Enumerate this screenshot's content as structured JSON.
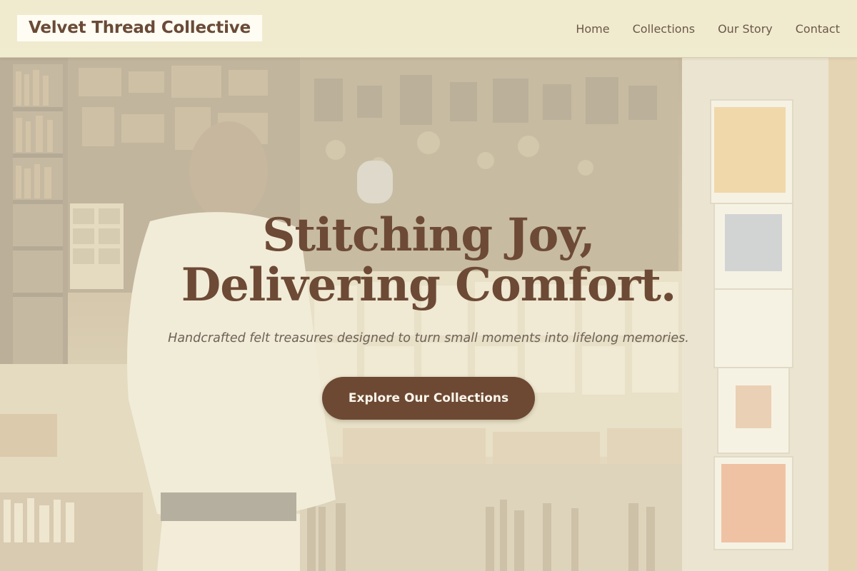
{
  "header": {
    "brand": "Velvet Thread Collective",
    "nav": [
      {
        "label": "Home"
      },
      {
        "label": "Collections"
      },
      {
        "label": "Our Story"
      },
      {
        "label": "Contact"
      }
    ]
  },
  "hero": {
    "title_line1": "Stitching Joy,",
    "title_line2": "Delivering Comfort.",
    "subtitle": "Handcrafted felt treasures designed to turn small moments into lifelong memories.",
    "cta_label": "Explore Our Collections",
    "background_image": "bookshop-interior-photo"
  },
  "colors": {
    "brand_brown": "#6d4934",
    "header_bg": "#f6f3d6",
    "nav_text": "#6d5748",
    "overlay": "#f6f1db"
  }
}
